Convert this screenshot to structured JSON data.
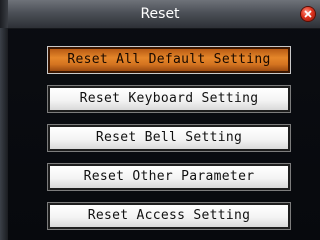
{
  "window": {
    "title": "Reset"
  },
  "menu": {
    "items": [
      {
        "label": "Reset All Default Setting",
        "selected": true
      },
      {
        "label": "Reset Keyboard Setting",
        "selected": false
      },
      {
        "label": "Reset Bell Setting",
        "selected": false
      },
      {
        "label": "Reset Other Parameter",
        "selected": false
      },
      {
        "label": "Reset Access Setting",
        "selected": false
      }
    ]
  },
  "colors": {
    "selected_accent": "#e5862a",
    "close_button": "#e0321c"
  },
  "icons": {
    "close": "close-icon"
  }
}
